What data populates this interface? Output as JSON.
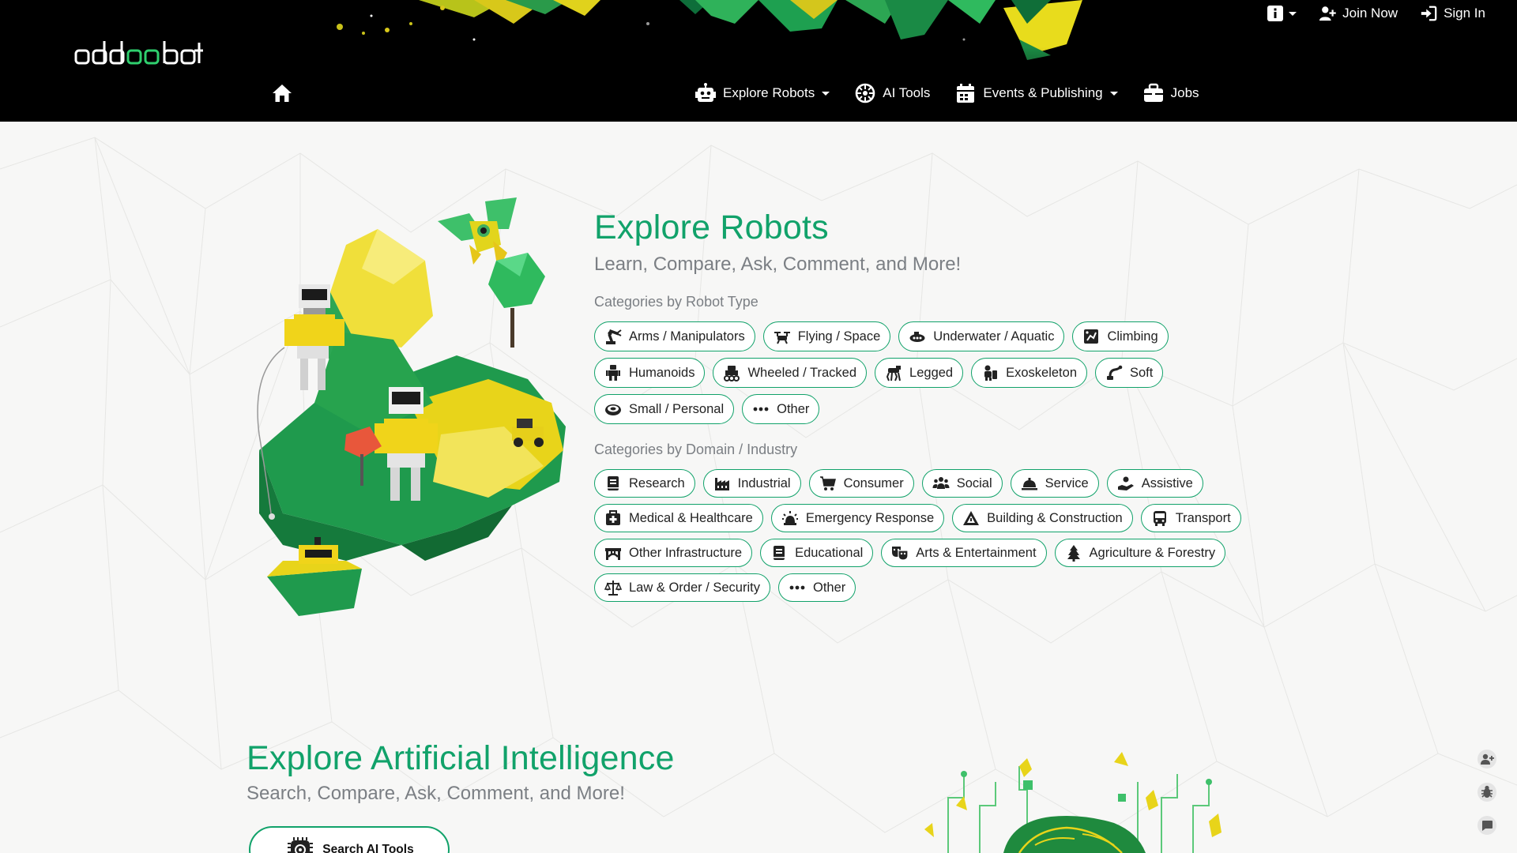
{
  "header": {
    "logo_text": "oddobot",
    "top_links": {
      "join": "Join Now",
      "signin": "Sign In"
    },
    "nav": {
      "explore_robots": "Explore Robots",
      "ai_tools": "AI Tools",
      "events": "Events & Publishing",
      "jobs": "Jobs"
    }
  },
  "robots": {
    "title": "Explore Robots",
    "subtitle": "Learn, Compare, Ask, Comment, and More!",
    "type_title": "Categories by Robot Type",
    "types": [
      {
        "label": "Arms / Manipulators",
        "icon": "robot-arm-icon"
      },
      {
        "label": "Flying / Space",
        "icon": "drone-icon"
      },
      {
        "label": "Underwater / Aquatic",
        "icon": "submarine-icon"
      },
      {
        "label": "Climbing",
        "icon": "climbing-robot-icon"
      },
      {
        "label": "Humanoids",
        "icon": "humanoid-icon"
      },
      {
        "label": "Wheeled / Tracked",
        "icon": "wheeled-robot-icon"
      },
      {
        "label": "Legged",
        "icon": "legged-robot-icon"
      },
      {
        "label": "Exoskeleton",
        "icon": "exoskeleton-icon"
      },
      {
        "label": "Soft",
        "icon": "soft-robot-icon"
      },
      {
        "label": "Small / Personal",
        "icon": "robot-vacuum-icon"
      },
      {
        "label": "Other",
        "icon": "ellipsis-icon"
      }
    ],
    "domain_title": "Categories by Domain / Industry",
    "domains": [
      {
        "label": "Research",
        "icon": "book-icon"
      },
      {
        "label": "Industrial",
        "icon": "industry-icon"
      },
      {
        "label": "Consumer",
        "icon": "cart-icon"
      },
      {
        "label": "Social",
        "icon": "people-icon"
      },
      {
        "label": "Service",
        "icon": "bell-service-icon"
      },
      {
        "label": "Assistive",
        "icon": "helping-hand-icon"
      },
      {
        "label": "Medical & Healthcare",
        "icon": "medical-kit-icon"
      },
      {
        "label": "Emergency Response",
        "icon": "siren-icon"
      },
      {
        "label": "Building & Construction",
        "icon": "warning-triangle-icon"
      },
      {
        "label": "Transport",
        "icon": "bus-icon"
      },
      {
        "label": "Other Infrastructure",
        "icon": "bridge-icon"
      },
      {
        "label": "Educational",
        "icon": "book-icon"
      },
      {
        "label": "Arts & Entertainment",
        "icon": "masks-icon"
      },
      {
        "label": "Agriculture & Forestry",
        "icon": "tree-icon"
      },
      {
        "label": "Law & Order / Security",
        "icon": "scale-icon"
      },
      {
        "label": "Other",
        "icon": "ellipsis-icon"
      }
    ]
  },
  "ai": {
    "title": "Explore Artificial Intelligence",
    "subtitle": "Search, Compare, Ask, Comment, and More!",
    "button": "Search AI Tools"
  },
  "colors": {
    "accent": "#11a26a",
    "header_bg": "#000000",
    "subtitle": "#7b7f84"
  }
}
